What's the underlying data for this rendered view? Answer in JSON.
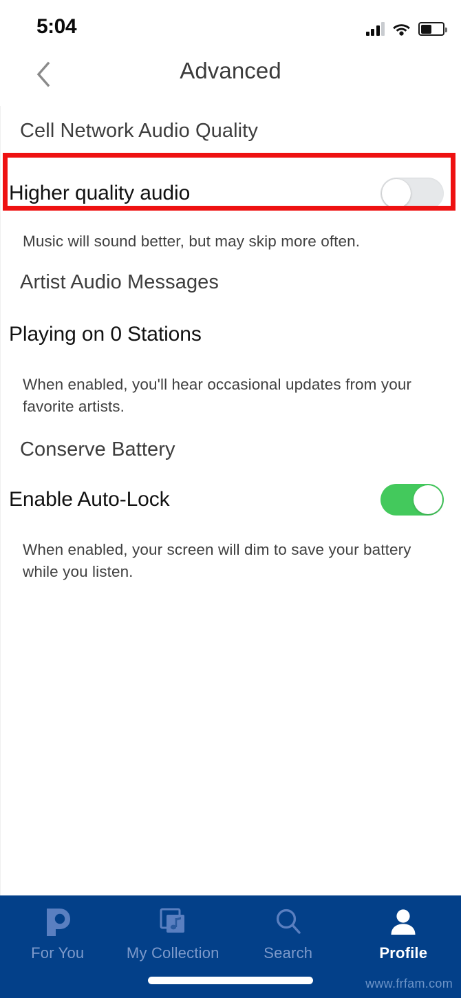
{
  "status_bar": {
    "time": "5:04",
    "signal_icon": "signal-bars-icon",
    "signal_bars_filled": 3,
    "signal_bars_total": 4,
    "wifi_icon": "wifi-icon",
    "battery_icon": "battery-icon",
    "battery_level_percent": 45
  },
  "header": {
    "back_icon": "chevron-left-icon",
    "title": "Advanced"
  },
  "settings": [
    {
      "section_header": "Cell Network Audio Quality",
      "row_label": "Higher quality audio",
      "control": "toggle",
      "toggle_state": "off",
      "description": "Music will sound better, but may skip more often.",
      "highlighted": true
    },
    {
      "section_header": "Artist Audio Messages",
      "row_label": "Playing on 0 Stations",
      "control": "none",
      "description": "When enabled, you'll hear occasional updates from your favorite artists.",
      "highlighted": false
    },
    {
      "section_header": "Conserve Battery",
      "row_label": "Enable Auto-Lock",
      "control": "toggle",
      "toggle_state": "on",
      "description": "When enabled, your screen will dim to save your battery while you listen.",
      "highlighted": false
    }
  ],
  "tab_bar": {
    "tabs": [
      {
        "label": "For You",
        "icon": "pandora-p-logo-icon",
        "active": false
      },
      {
        "label": "My Collection",
        "icon": "stacked-cards-music-note-icon",
        "active": false
      },
      {
        "label": "Search",
        "icon": "search-icon",
        "active": false
      },
      {
        "label": "Profile",
        "icon": "person-icon",
        "active": true
      }
    ]
  },
  "watermark": {
    "text": "www.frfam.com"
  },
  "colors": {
    "tab_bar_background": "#034089",
    "tab_label_inactive": "#7d9acb",
    "tab_label_active": "#ffffff",
    "toggle_on": "#43c95c",
    "toggle_off_track": "#e6e8ea",
    "highlight_annotation": "#ee1111",
    "section_header_text": "#3d3d3d",
    "row_label_text": "#111111",
    "description_text": "#3f3f3f"
  }
}
